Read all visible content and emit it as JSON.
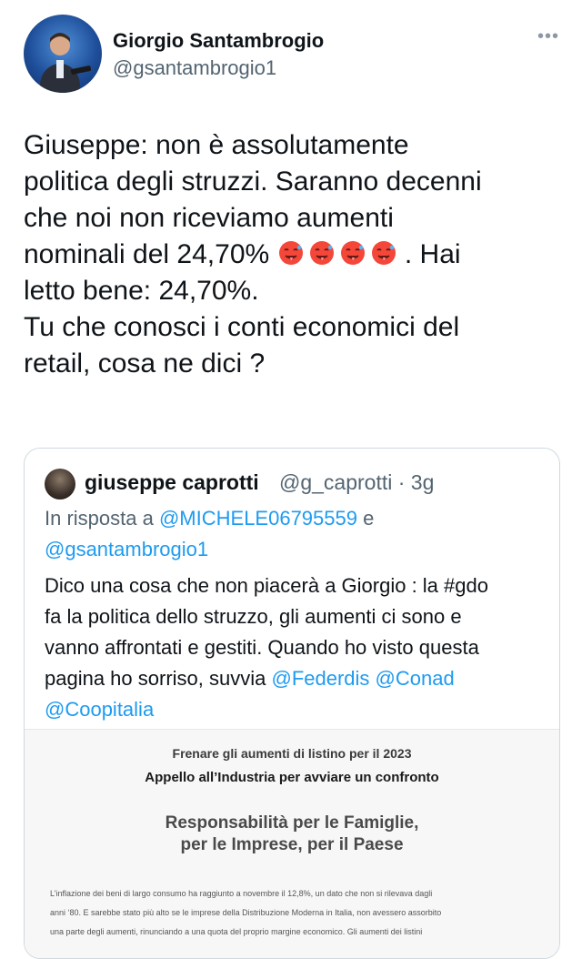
{
  "author": {
    "name": "Giorgio Santambrogio",
    "handle": "@gsantambrogio1"
  },
  "more_icon": "more-horizontal-icon",
  "tweet": {
    "line1": "Giuseppe: non è assolutamente",
    "line2": "politica degli struzzi. Saranno decenni",
    "line3": "che noi non riceviamo aumenti",
    "line4_a": "nominali del 24,70%",
    "line4_b": ". Hai",
    "line5": "letto bene: 24,70%.",
    "line6": "Tu che conosci i conti economici del",
    "line7": "retail, cosa ne dici ?",
    "emoji": [
      "hot-face-icon",
      "hot-face-icon",
      "hot-face-icon",
      "hot-face-icon"
    ]
  },
  "quote": {
    "name": "giuseppe caprotti",
    "handle_time": "@g_caprotti · 3g",
    "reply_prefix": "In risposta a",
    "reply_mention1": "@MICHELE06795559",
    "reply_and": "e",
    "reply_mention2": "@gsantambrogio1",
    "text_line1": "Dico una cosa che non piacerà a Giorgio : la #gdo",
    "text_line2": "fa la politica dello struzzo, gli aumenti ci sono e",
    "text_line3": "vanno affrontati e gestiti. Quando ho visto questa",
    "text_line4_a": "pagina ho sorriso, suvvia",
    "mention_federdis": "@Federdis",
    "mention_conad": "@Conad",
    "mention_coop": "@Coopitalia"
  },
  "document": {
    "title1": "Frenare gli aumenti di listino per il 2023",
    "title2": "Appello all’Industria per avviare un confronto",
    "subtitle1": "Responsabilità per le Famiglie,",
    "subtitle2": "per le Imprese, per il Paese",
    "body1": "L’inflazione dei beni di largo consumo ha raggiunto a novembre il 12,8%, un dato che non si rilevava dagli",
    "body2": "anni ‘80. E sarebbe stato più alto se le imprese della Distribuzione Moderna in Italia, non avessero assorbito",
    "body3": "una parte degli aumenti, rinunciando a una quota del proprio margine economico. Gli aumenti dei listini"
  },
  "colors": {
    "link": "#1d9bf0",
    "secondary_text": "#536471",
    "border": "#cfd9de"
  }
}
